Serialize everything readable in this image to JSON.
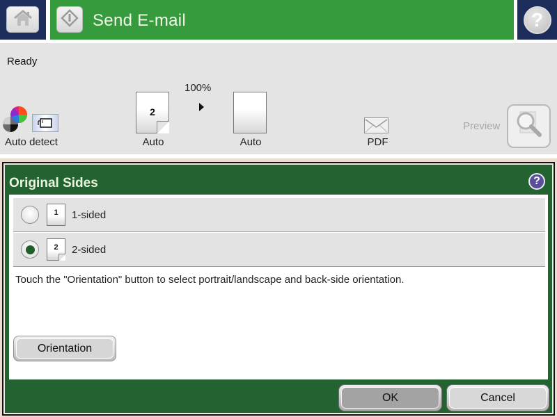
{
  "header": {
    "title": "Send E-mail",
    "home_icon": "home-icon",
    "start_icon": "start-diamond-icon",
    "help_icon": "help-icon",
    "help_glyph": "?",
    "colors": {
      "title_bar": "#369b3c",
      "side_tiles": "#1c2d5c"
    }
  },
  "status": {
    "text": "Ready"
  },
  "settings": {
    "color_mode": {
      "label": "Auto detect",
      "icon": "color-wheel-icon"
    },
    "original_sides": {
      "label": "Auto",
      "page_number": "2",
      "icon": "two-sided-page-icon"
    },
    "scale": {
      "value": "100%",
      "icon": "arrow-right-icon"
    },
    "output_sides": {
      "label": "Auto",
      "icon": "blank-page-icon"
    },
    "file_type": {
      "label": "PDF",
      "icon": "envelope-icon"
    },
    "preview": {
      "label": "Preview",
      "icon": "magnifier-icon",
      "enabled": false
    }
  },
  "dialog": {
    "title": "Original Sides",
    "help_glyph": "?",
    "options": [
      {
        "label": "1-sided",
        "page_number": "1",
        "selected": false
      },
      {
        "label": "2-sided",
        "page_number": "2",
        "selected": true
      }
    ],
    "hint": "Touch the \"Orientation\" button to select portrait/landscape and back-side orientation.",
    "orientation_button": "Orientation",
    "ok_button": "OK",
    "cancel_button": "Cancel",
    "colors": {
      "frame": "#236231",
      "selected_radio": "#1f5d2a"
    }
  }
}
